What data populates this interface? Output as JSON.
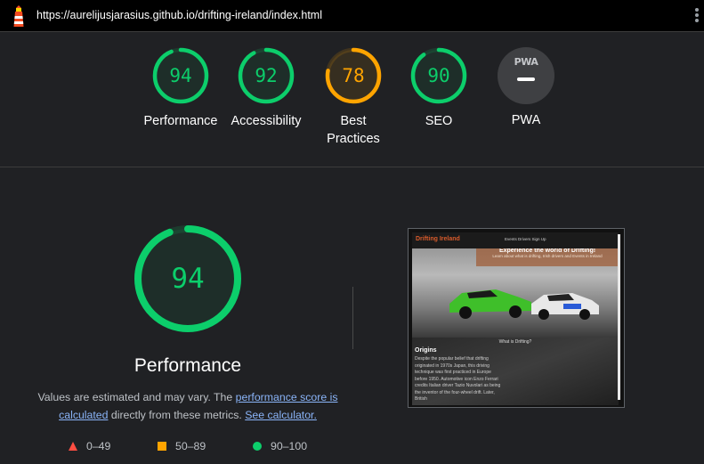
{
  "browser": {
    "url": "https://aurelijusjarasius.github.io/drifting-ireland/index.html"
  },
  "colors": {
    "pass": "#0cce6b",
    "average": "#ffa400",
    "fail": "#ff4e42",
    "background": "#202124"
  },
  "gauges": [
    {
      "label": "Performance",
      "score": "94",
      "rating": "pass"
    },
    {
      "label": "Accessibility",
      "score": "92",
      "rating": "pass"
    },
    {
      "label": "Best Practices",
      "score": "78",
      "rating": "average"
    },
    {
      "label": "SEO",
      "score": "90",
      "rating": "pass"
    },
    {
      "label": "PWA",
      "badge": "PWA",
      "rating": "na"
    }
  ],
  "performance": {
    "score": "94",
    "title": "Performance",
    "note_before": "Values are estimated and may vary. The ",
    "note_link1": "performance score is calculated",
    "note_middle": " directly from these metrics. ",
    "note_link2": "See calculator."
  },
  "legend": [
    {
      "range": "0–49",
      "icon": "red-triangle-icon"
    },
    {
      "range": "50–89",
      "icon": "orange-square-icon"
    },
    {
      "range": "90–100",
      "icon": "green-circle-icon"
    }
  ],
  "screenshot": {
    "brand": "Drifting Ireland",
    "nav_links": "Events   Drivers   Sign Up",
    "hero_heading": "Experience the world of Drifting!",
    "hero_sub": "Learn about what is drifting, Irish drivers and Events in Ireland",
    "what_heading": "What is Drifting?",
    "origins_heading": "Origins",
    "origins_text": "Despite the popular belief that drifting originated in 1970s Japan, this driving technique was first practiced in Europe before 1950. Automotive icon Enzo Ferrari credits Italian driver Tazio Nuvolari as being the inventor of the four-wheel drift. Later, British"
  }
}
